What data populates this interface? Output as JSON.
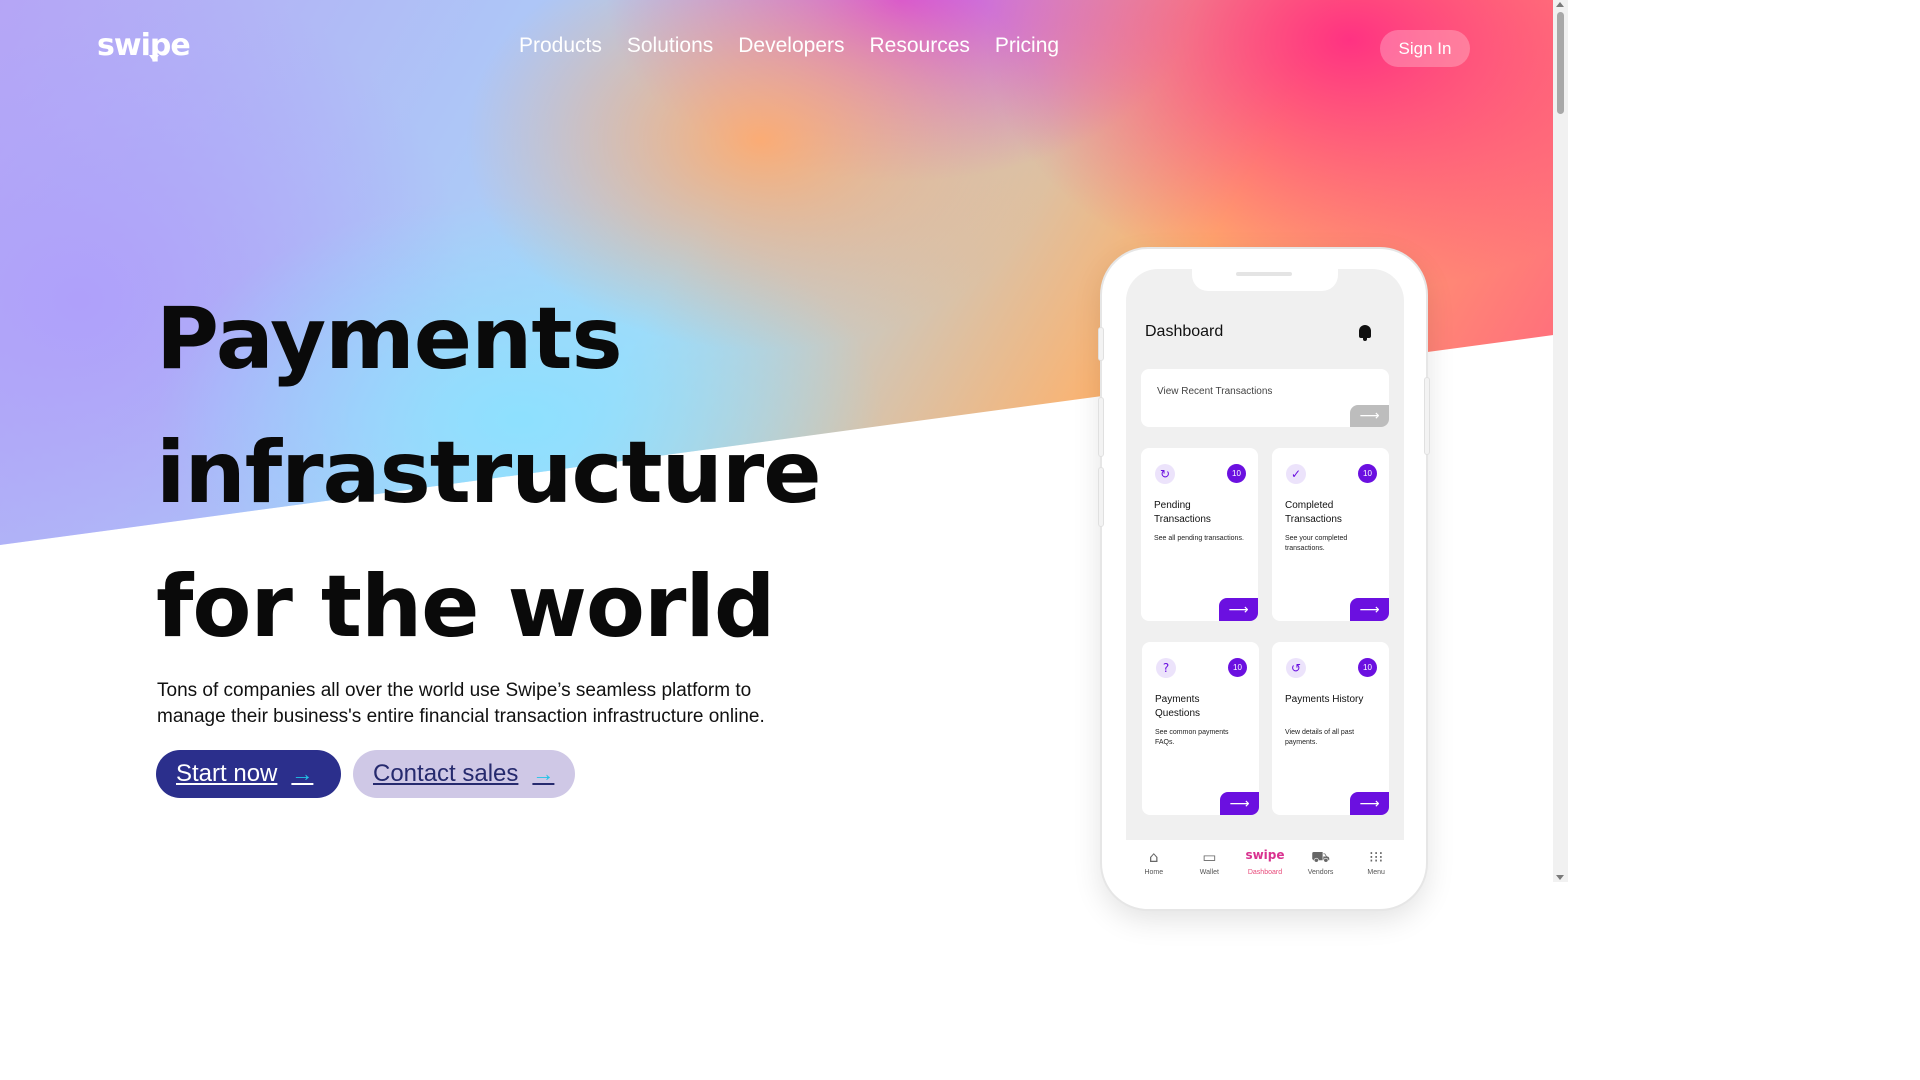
{
  "brand": {
    "logo_text": "swipe"
  },
  "nav": {
    "items": [
      {
        "label": "Products"
      },
      {
        "label": "Solutions"
      },
      {
        "label": "Developers"
      },
      {
        "label": "Resources"
      },
      {
        "label": "Pricing"
      }
    ],
    "sign_in_label": "Sign In"
  },
  "hero": {
    "headline_lines": [
      "Payments",
      "infrastructure",
      "for the world"
    ],
    "subtext": "Tons of companies all over the world use Swipe’s seamless platform to manage their business's entire financial transaction infrastructure online.",
    "primary_cta": {
      "label": "Start now",
      "arrow": "→"
    },
    "secondary_cta": {
      "label": "Contact sales",
      "arrow": "→"
    }
  },
  "phone": {
    "dashboard_title": "Dashboard",
    "recent": {
      "label": "View Recent Transactions",
      "arrow": "⟶"
    },
    "cards": [
      {
        "icon": "refresh-icon",
        "glyph": "↻",
        "badge": "10",
        "title": "Pending Transactions",
        "desc": "See all pending transactions.",
        "arrow": "⟶"
      },
      {
        "icon": "check-circle-icon",
        "glyph": "✓",
        "badge": "10",
        "title": "Completed Transactions",
        "desc": "See your completed transactions.",
        "arrow": "⟶"
      },
      {
        "icon": "question-icon",
        "glyph": "?",
        "badge": "10",
        "title": "Payments Questions",
        "desc": "See common payments FAQs.",
        "arrow": "⟶"
      },
      {
        "icon": "history-icon",
        "glyph": "↺",
        "badge": "10",
        "title": "Payments History",
        "desc": "View details of all past payments.",
        "arrow": "⟶"
      }
    ],
    "tabs": [
      {
        "label": "Home",
        "icon": "home-icon",
        "glyph": "⌂"
      },
      {
        "label": "Wallet",
        "icon": "wallet-icon",
        "glyph": "▭"
      },
      {
        "label": "Dashboard",
        "icon": "swipe-logo-icon",
        "glyph": "swipe",
        "active": true
      },
      {
        "label": "Vendors",
        "icon": "cart-icon",
        "glyph": "⛟"
      },
      {
        "label": "Menu",
        "icon": "grid-menu-icon",
        "glyph": "⁝⁝⁝"
      }
    ]
  },
  "colors": {
    "primary_button": "#2b2f8c",
    "secondary_button": "#cfc8e6",
    "accent_purple": "#6b10e0",
    "arrow_cyan": "#22c3e6"
  }
}
